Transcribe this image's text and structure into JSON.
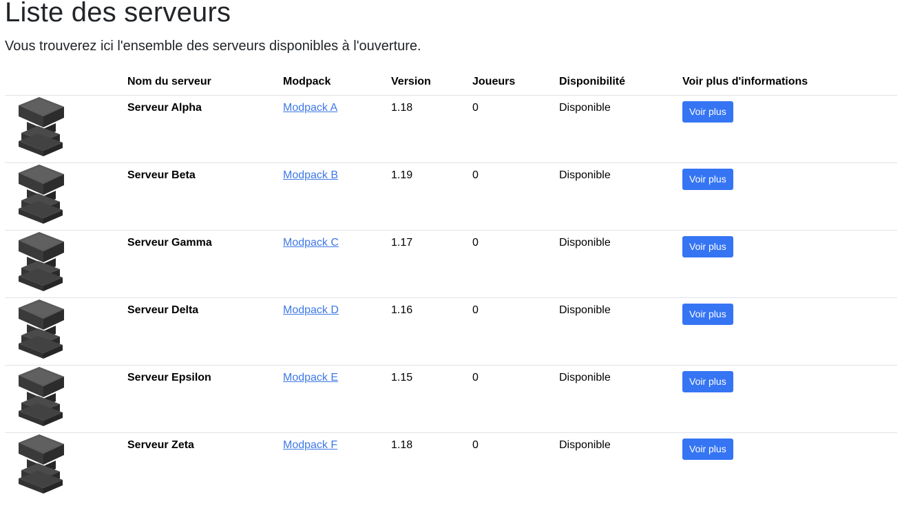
{
  "page": {
    "title": "Liste des serveurs",
    "subtitle": "Vous trouverez ici l'ensemble des serveurs disponibles à l'ouverture."
  },
  "table": {
    "headers": {
      "image": "",
      "name": "Nom du serveur",
      "modpack": "Modpack",
      "version": "Version",
      "players": "Joueurs",
      "availability": "Disponibilité",
      "more": "Voir plus d'informations"
    },
    "rows": [
      {
        "name": "Serveur Alpha",
        "modpack": "Modpack A",
        "version": "1.18",
        "players": "0",
        "availability": "Disponible",
        "button": "Voir plus",
        "icon": "anvil-icon"
      },
      {
        "name": "Serveur Beta",
        "modpack": "Modpack B",
        "version": "1.19",
        "players": "0",
        "availability": "Disponible",
        "button": "Voir plus",
        "icon": "anvil-icon"
      },
      {
        "name": "Serveur Gamma",
        "modpack": "Modpack C",
        "version": "1.17",
        "players": "0",
        "availability": "Disponible",
        "button": "Voir plus",
        "icon": "anvil-icon"
      },
      {
        "name": "Serveur Delta",
        "modpack": "Modpack D",
        "version": "1.16",
        "players": "0",
        "availability": "Disponible",
        "button": "Voir plus",
        "icon": "anvil-icon"
      },
      {
        "name": "Serveur Epsilon",
        "modpack": "Modpack E",
        "version": "1.15",
        "players": "0",
        "availability": "Disponible",
        "button": "Voir plus",
        "icon": "anvil-icon"
      },
      {
        "name": "Serveur Zeta",
        "modpack": "Modpack F",
        "version": "1.18",
        "players": "0",
        "availability": "Disponible",
        "button": "Voir plus",
        "icon": "anvil-icon"
      }
    ]
  },
  "colors": {
    "button_bg": "#3575f4",
    "link": "#3d78e5",
    "border": "#dee2e6"
  }
}
